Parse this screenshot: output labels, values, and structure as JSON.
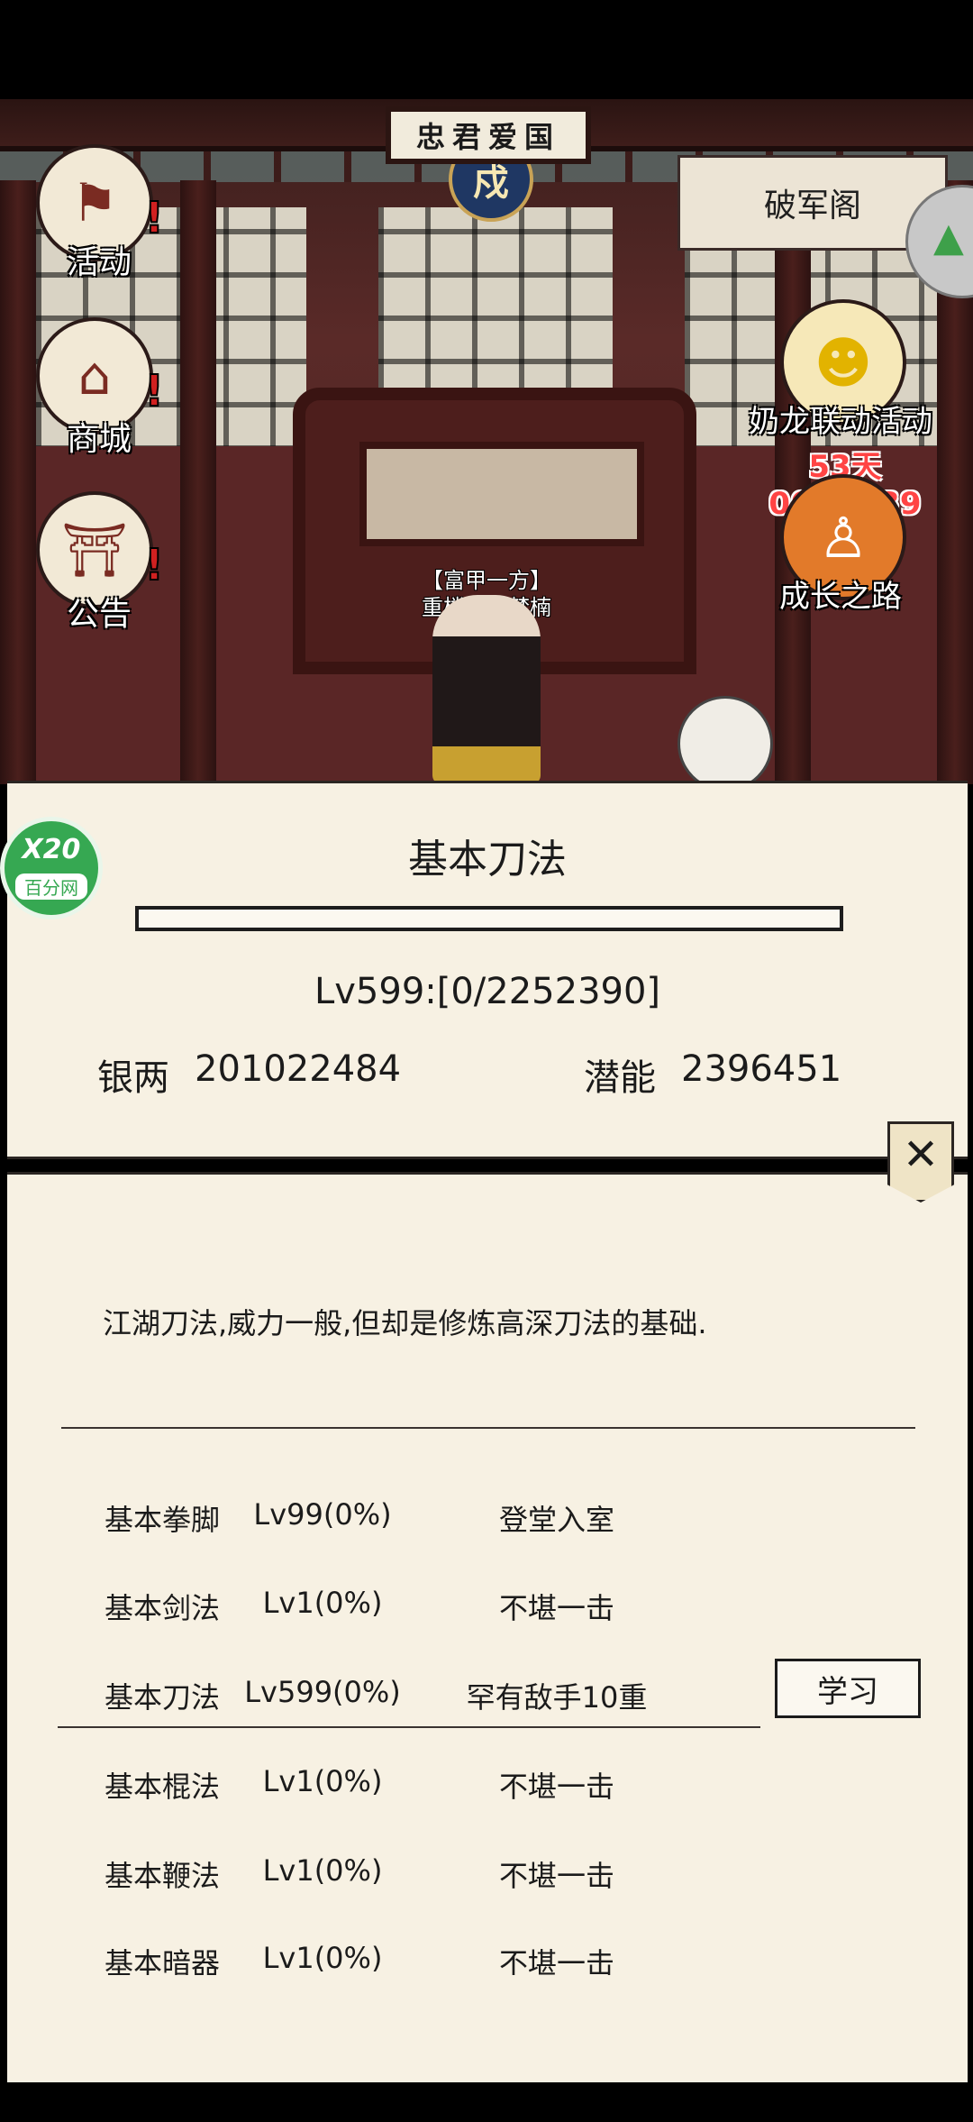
{
  "scene": {
    "plaque_text": "忠君爱国",
    "emblem_glyph": "戍",
    "location_tab": "破军阁",
    "left_menu": [
      {
        "label": "活动",
        "icon": "flag-icon"
      },
      {
        "label": "商城",
        "icon": "shop-icon"
      },
      {
        "label": "公告",
        "icon": "notice-board-icon"
      }
    ],
    "right_menu": {
      "event_label": "奶龙联动活动",
      "event_timer": "53天06:09:39",
      "growth_label": "成长之路"
    },
    "npc": {
      "title": "【富甲一方】",
      "name": "重楼丶王梦楠"
    }
  },
  "skill_panel": {
    "title": "基本刀法",
    "level_text": "Lv599:[0/2252390]",
    "progress": 0,
    "silver_label": "银两",
    "silver_value": "201022484",
    "potential_label": "潜能",
    "potential_value": "2396451"
  },
  "badge": {
    "top": "X20",
    "bottom": "百分网"
  },
  "detail_panel": {
    "close_label": "✕",
    "description": "江湖刀法,威力一般,但却是修炼高深刀法的基础.",
    "skills": [
      {
        "name": "基本拳脚",
        "level": "Lv99(0%)",
        "rank": "登堂入室"
      },
      {
        "name": "基本剑法",
        "level": "Lv1(0%)",
        "rank": "不堪一击"
      },
      {
        "name": "基本刀法",
        "level": "Lv599(0%)",
        "rank": "罕有敌手10重",
        "action": "学习"
      },
      {
        "name": "基本棍法",
        "level": "Lv1(0%)",
        "rank": "不堪一击"
      },
      {
        "name": "基本鞭法",
        "level": "Lv1(0%)",
        "rank": "不堪一击"
      },
      {
        "name": "基本暗器",
        "level": "Lv1(0%)",
        "rank": "不堪一击"
      }
    ]
  }
}
